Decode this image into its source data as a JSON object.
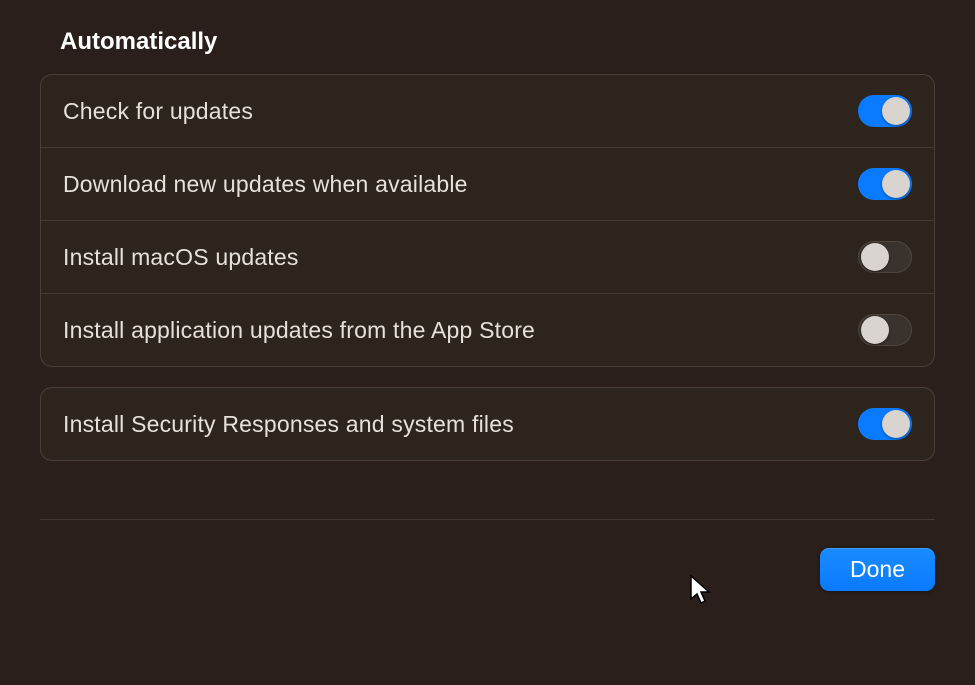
{
  "section_title": "Automatically",
  "group1": {
    "rows": [
      {
        "label": "Check for updates",
        "on": true,
        "name": "check-for-updates"
      },
      {
        "label": "Download new updates when available",
        "on": true,
        "name": "download-new-updates"
      },
      {
        "label": "Install macOS updates",
        "on": false,
        "name": "install-macos-updates"
      },
      {
        "label": "Install application updates from the App Store",
        "on": false,
        "name": "install-app-store-updates"
      }
    ]
  },
  "group2": {
    "rows": [
      {
        "label": "Install Security Responses and system files",
        "on": true,
        "name": "install-security-responses"
      }
    ]
  },
  "done_label": "Done"
}
